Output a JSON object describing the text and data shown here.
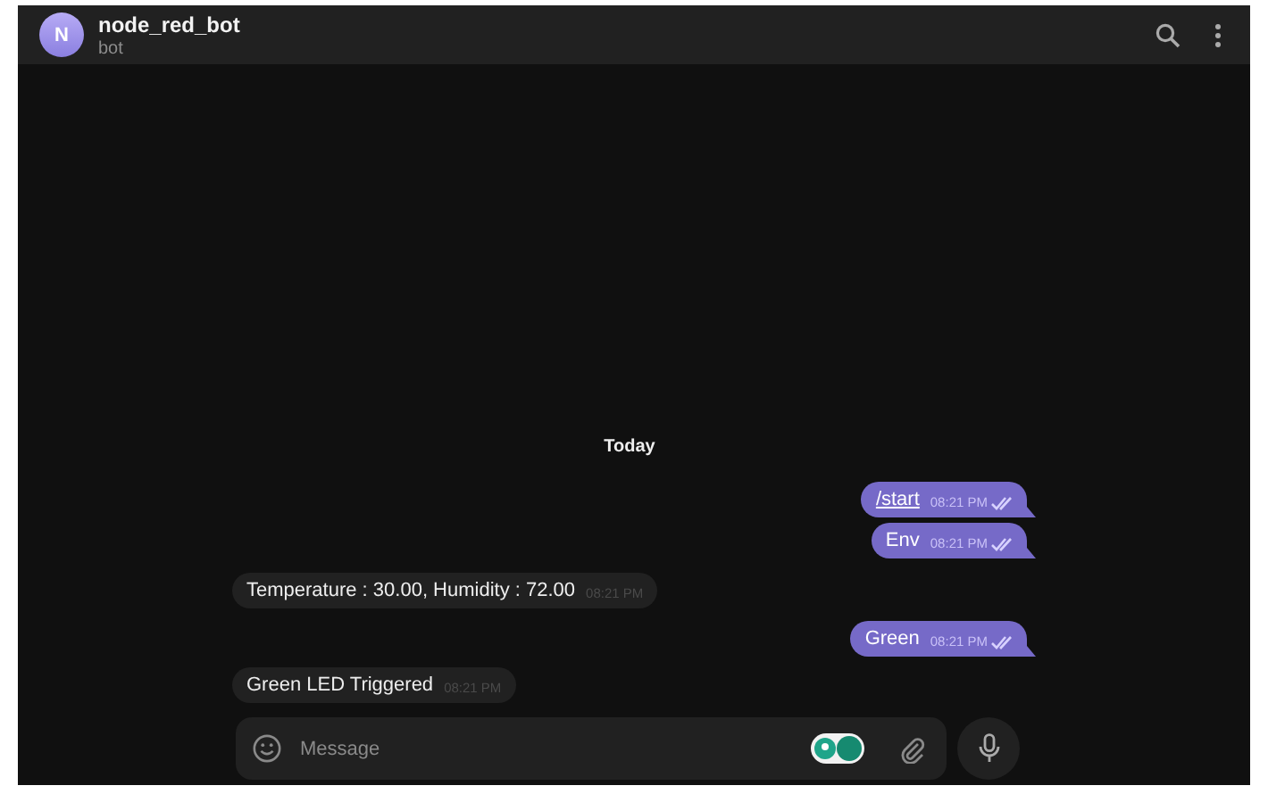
{
  "header": {
    "avatar_letter": "N",
    "title": "node_red_bot",
    "subtitle": "bot"
  },
  "date_separator": "Today",
  "messages": [
    {
      "kind": "out",
      "text": "/start",
      "link": true,
      "time": "08:21 PM",
      "read": true
    },
    {
      "kind": "out",
      "text": "Env",
      "link": false,
      "time": "08:21 PM",
      "read": true
    },
    {
      "kind": "in",
      "text": "Temperature : 30.00, Humidity : 72.00",
      "link": false,
      "time": "08:21 PM"
    },
    {
      "kind": "out",
      "text": "Green",
      "link": false,
      "time": "08:21 PM",
      "read": true
    },
    {
      "kind": "in",
      "text": "Green LED Triggered",
      "link": false,
      "time": "08:21 PM"
    }
  ],
  "composer": {
    "placeholder": "Message"
  }
}
